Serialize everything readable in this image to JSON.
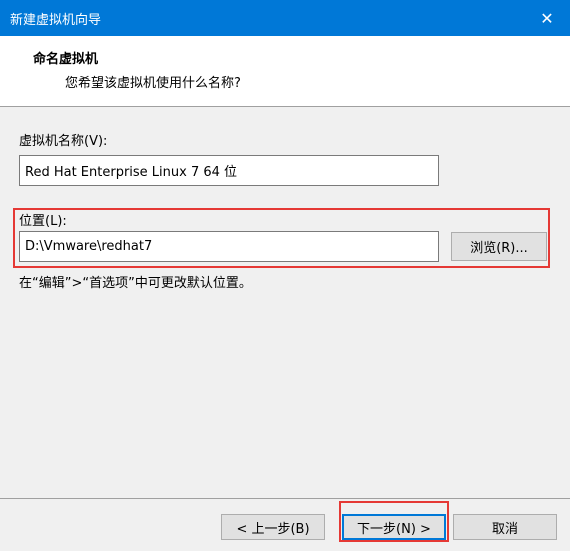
{
  "window": {
    "title": "新建虚拟机向导",
    "close_glyph": "✕"
  },
  "header": {
    "title": "命名虚拟机",
    "subtitle": "您希望该虚拟机使用什么名称?"
  },
  "vm_name": {
    "label": "虚拟机名称(V):",
    "value": "Red Hat Enterprise Linux 7 64 位"
  },
  "location": {
    "label": "位置(L):",
    "value": "D:\\Vmware\\redhat7",
    "browse_label": "浏览(R)...",
    "hint": "在“编辑”>“首选项”中可更改默认位置。"
  },
  "footer": {
    "back_label": "< 上一步(B)",
    "next_label": "下一步(N) >",
    "cancel_label": "取消"
  },
  "colors": {
    "titlebar": "#0078d7",
    "highlight": "#e53935",
    "dialog_bg": "#f0f0f0",
    "header_bg": "#ffffff"
  }
}
